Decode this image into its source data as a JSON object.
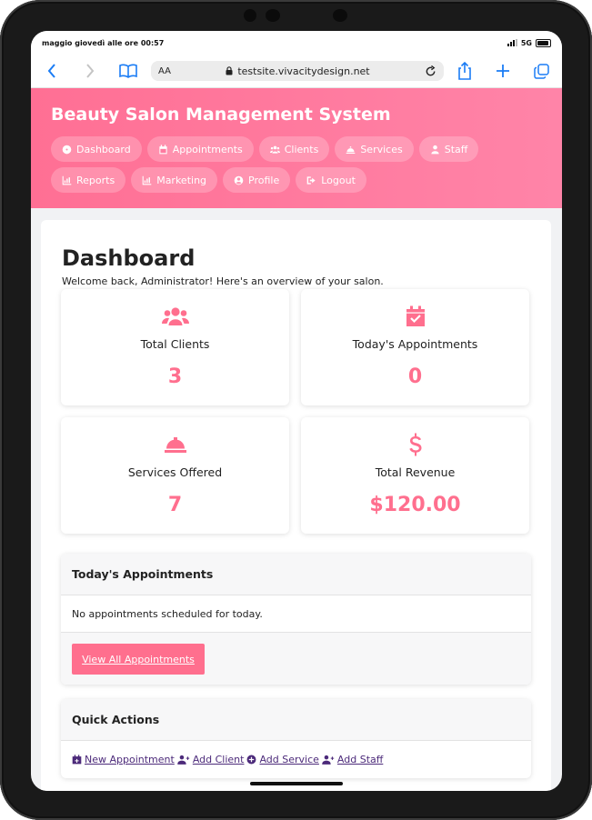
{
  "status_bar": {
    "time": "maggio giovedì alle ore 00:57",
    "network": "5G"
  },
  "browser": {
    "text_size": "AA",
    "url": "testsite.vivacitydesign.net"
  },
  "app": {
    "title": "Beauty Salon Management System",
    "nav": [
      {
        "label": "Dashboard",
        "icon": "dashboard-icon"
      },
      {
        "label": "Appointments",
        "icon": "calendar-icon"
      },
      {
        "label": "Clients",
        "icon": "users-icon"
      },
      {
        "label": "Services",
        "icon": "bell-concierge-icon"
      },
      {
        "label": "Staff",
        "icon": "user-icon"
      },
      {
        "label": "Reports",
        "icon": "chart-icon"
      },
      {
        "label": "Marketing",
        "icon": "chart-icon"
      },
      {
        "label": "Profile",
        "icon": "user-circle-icon"
      },
      {
        "label": "Logout",
        "icon": "logout-icon"
      }
    ]
  },
  "dashboard": {
    "title": "Dashboard",
    "welcome": "Welcome back, Administrator! Here's an overview of your salon.",
    "stats": [
      {
        "label": "Total Clients",
        "value": "3",
        "icon": "users-icon"
      },
      {
        "label": "Today's Appointments",
        "value": "0",
        "icon": "calendar-check-icon"
      },
      {
        "label": "Services Offered",
        "value": "7",
        "icon": "bell-concierge-icon"
      },
      {
        "label": "Total Revenue",
        "value": "$120.00",
        "icon": "dollar-icon"
      }
    ],
    "todays_appointments": {
      "title": "Today's Appointments",
      "empty": "No appointments scheduled for today.",
      "button": "View All Appointments"
    },
    "quick_actions": {
      "title": "Quick Actions",
      "links": [
        {
          "label": "New Appointment",
          "icon": "calendar-plus-icon"
        },
        {
          "label": "Add Client",
          "icon": "user-plus-icon"
        },
        {
          "label": "Add Service",
          "icon": "plus-circle-icon"
        },
        {
          "label": "Add Staff",
          "icon": "user-plus-icon"
        }
      ]
    }
  },
  "colors": {
    "accent": "#ff6f8e",
    "header_gradient_start": "#ff6f94",
    "header_gradient_end": "#ff84a8",
    "link": "#4c2a7a",
    "ios_blue": "#1a7cf5"
  }
}
